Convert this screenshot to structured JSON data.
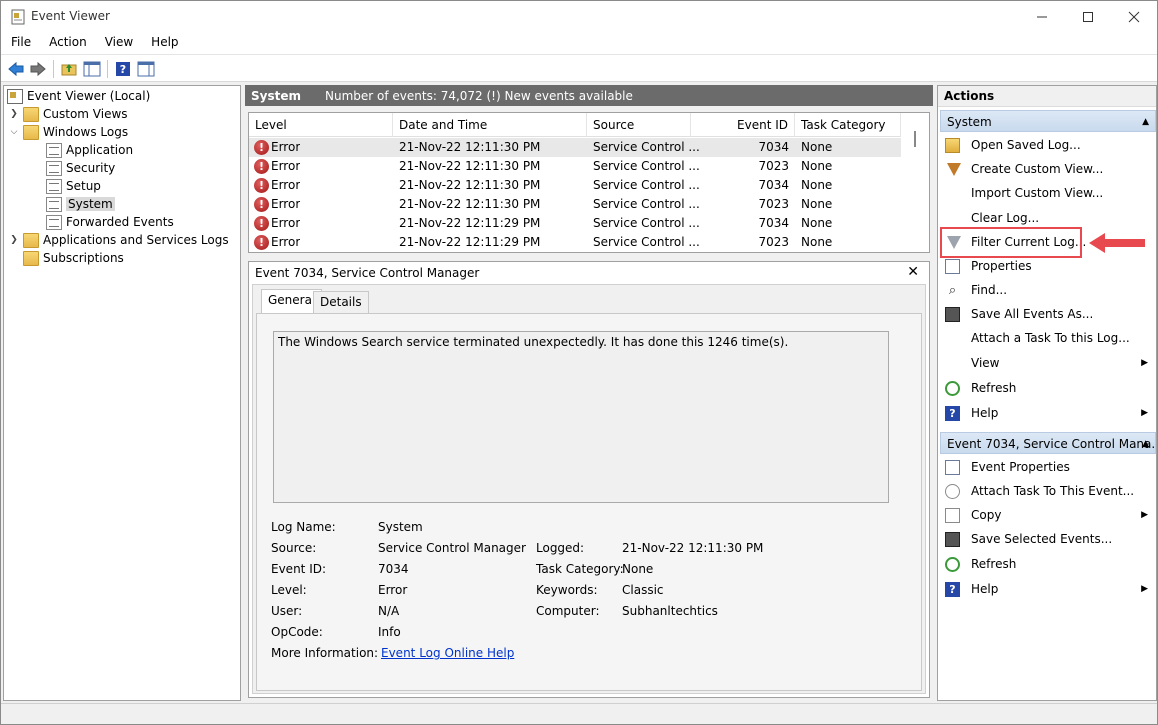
{
  "window": {
    "title": "Event Viewer",
    "controls": [
      "minimize",
      "maximize",
      "close"
    ]
  },
  "menu": [
    "File",
    "Action",
    "View",
    "Help"
  ],
  "toolbar": [
    "back-icon",
    "forward-icon",
    "up-folder-icon",
    "show-hide-tree-icon",
    "help-icon",
    "show-hide-actions-icon"
  ],
  "tree": {
    "root": "Event Viewer (Local)",
    "items": [
      {
        "label": "Custom Views",
        "level": 1,
        "expander": "collapsed"
      },
      {
        "label": "Windows Logs",
        "level": 1,
        "expander": "expanded"
      },
      {
        "label": "Application",
        "level": 2
      },
      {
        "label": "Security",
        "level": 2
      },
      {
        "label": "Setup",
        "level": 2
      },
      {
        "label": "System",
        "level": 2,
        "selected": true
      },
      {
        "label": "Forwarded Events",
        "level": 2
      },
      {
        "label": "Applications and Services Logs",
        "level": 1,
        "expander": "collapsed"
      },
      {
        "label": "Subscriptions",
        "level": 1
      }
    ]
  },
  "center": {
    "log_name": "System",
    "count_text": "Number of events: 74,072 (!) New events available"
  },
  "events": {
    "columns": [
      "Level",
      "Date and Time",
      "Source",
      "Event ID",
      "Task Category"
    ],
    "rows": [
      {
        "level": "Error",
        "date": "21-Nov-22 12:11:30 PM",
        "source": "Service Control ...",
        "id": "7034",
        "category": "None"
      },
      {
        "level": "Error",
        "date": "21-Nov-22 12:11:30 PM",
        "source": "Service Control ...",
        "id": "7023",
        "category": "None"
      },
      {
        "level": "Error",
        "date": "21-Nov-22 12:11:30 PM",
        "source": "Service Control ...",
        "id": "7034",
        "category": "None"
      },
      {
        "level": "Error",
        "date": "21-Nov-22 12:11:30 PM",
        "source": "Service Control ...",
        "id": "7023",
        "category": "None"
      },
      {
        "level": "Error",
        "date": "21-Nov-22 12:11:29 PM",
        "source": "Service Control ...",
        "id": "7034",
        "category": "None"
      },
      {
        "level": "Error",
        "date": "21-Nov-22 12:11:29 PM",
        "source": "Service Control ...",
        "id": "7023",
        "category": "None"
      }
    ]
  },
  "detail": {
    "title": "Event 7034, Service Control Manager",
    "close_glyph": "✕",
    "tabs": [
      "General",
      "Details"
    ],
    "description": "The Windows Search service terminated unexpectedly.  It has done this 1246 time(s).",
    "props": {
      "log_name_label": "Log Name:",
      "log_name": "System",
      "source_label": "Source:",
      "source": "Service Control Manager",
      "logged_label": "Logged:",
      "logged": "21-Nov-22 12:11:30 PM",
      "event_id_label": "Event ID:",
      "event_id": "7034",
      "task_category_label": "Task Category:",
      "task_category": "None",
      "level_label": "Level:",
      "level": "Error",
      "keywords_label": "Keywords:",
      "keywords": "Classic",
      "user_label": "User:",
      "user": "N/A",
      "computer_label": "Computer:",
      "computer": "Subhanltechtics",
      "opcode_label": "OpCode:",
      "opcode": "Info",
      "more_info_label": "More Information:",
      "more_info_link": "Event Log Online Help"
    }
  },
  "actions": {
    "header": "Actions",
    "section1": "System",
    "items1": [
      {
        "label": "Open Saved Log...",
        "icon": "open-log-icon"
      },
      {
        "label": "Create Custom View...",
        "icon": "custom-view-icon"
      },
      {
        "label": "Import Custom View...",
        "icon": ""
      },
      {
        "label": "Clear Log...",
        "icon": ""
      },
      {
        "label": "Filter Current Log...",
        "icon": "filter-icon"
      },
      {
        "label": "Properties",
        "icon": "properties-icon"
      },
      {
        "label": "Find...",
        "icon": "find-icon"
      },
      {
        "label": "Save All Events As...",
        "icon": "save-icon"
      },
      {
        "label": "Attach a Task To this Log...",
        "icon": ""
      },
      {
        "label": "View",
        "icon": "",
        "submenu": true
      },
      {
        "label": "Refresh",
        "icon": "refresh-icon"
      },
      {
        "label": "Help",
        "icon": "help-icon",
        "submenu": true
      }
    ],
    "section2": "Event 7034, Service Control Mana...",
    "items2": [
      {
        "label": "Event Properties",
        "icon": "event-properties-icon"
      },
      {
        "label": "Attach Task To This Event...",
        "icon": "attach-task-icon"
      },
      {
        "label": "Copy",
        "icon": "copy-icon",
        "submenu": true
      },
      {
        "label": "Save Selected Events...",
        "icon": "save-icon"
      },
      {
        "label": "Refresh",
        "icon": "refresh-icon"
      },
      {
        "label": "Help",
        "icon": "help-icon",
        "submenu": true
      }
    ]
  },
  "annotation": {
    "color": "#e8494e"
  }
}
